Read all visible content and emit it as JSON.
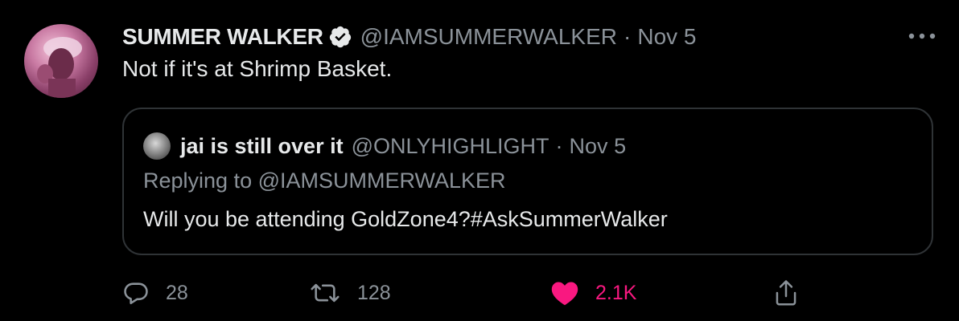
{
  "tweet": {
    "display_name": "SUMMER WALKER",
    "handle": "@IAMSUMMERWALKER",
    "separator": "·",
    "date": "Nov 5",
    "text": "Not if it's at Shrimp Basket.",
    "more_icon": "more-horizontal-icon",
    "verified_icon": "verified-badge-icon"
  },
  "quote": {
    "display_name": "jai is still over it",
    "handle": "@ONLYHIGHLIGHT",
    "separator": "·",
    "date": "Nov 5",
    "replying_to": "Replying to @IAMSUMMERWALKER",
    "text": "Will you be attending GoldZone4?#AskSummerWalker"
  },
  "actions": {
    "reply": {
      "icon": "reply-icon",
      "count": "28"
    },
    "retweet": {
      "icon": "retweet-icon",
      "count": "128"
    },
    "like": {
      "icon": "heart-filled-icon",
      "count": "2.1K",
      "liked": true
    },
    "share": {
      "icon": "share-icon"
    }
  },
  "colors": {
    "background": "#000000",
    "text_primary": "#e7e9ea",
    "text_secondary": "#8b9299",
    "border": "#2f3336",
    "like_pink": "#f91880"
  }
}
